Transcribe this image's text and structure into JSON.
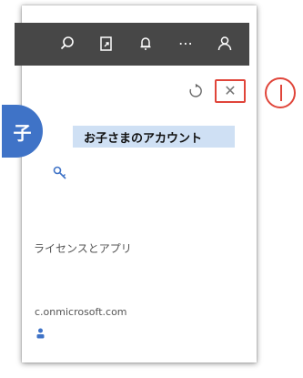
{
  "topbar": {
    "icons": [
      "search-icon",
      "share-icon",
      "bell-icon",
      "more-icon",
      "person-icon"
    ],
    "more_label": "⋯"
  },
  "panel_controls": {
    "icons": [
      "refresh-icon",
      "close-icon"
    ],
    "close_label": "✕"
  },
  "account": {
    "avatar_text": "子",
    "display_name": "お子さまのアカウント"
  },
  "sections": {
    "license_label": "ライセンスとアプリ",
    "domain_text": "c.onmicrosoft.com"
  },
  "colors": {
    "topbar_bg": "#474747",
    "avatar_bg": "#3f73c7",
    "highlight": "#e0453a",
    "name_highlight": "#cfe0f4"
  }
}
